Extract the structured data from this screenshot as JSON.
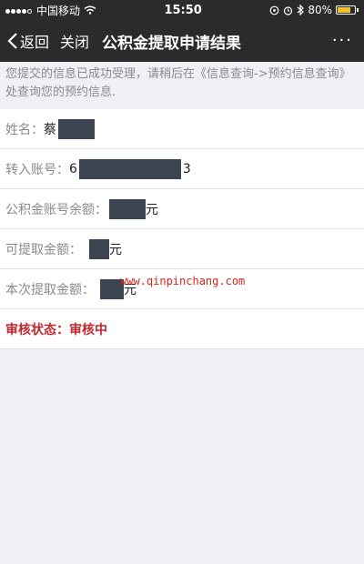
{
  "status_bar": {
    "carrier": "中国移动",
    "time": "15:50",
    "battery": "80%",
    "battery_level": 0.8,
    "wifi_icon": "wifi-icon",
    "alarm_icon": "alarm-icon",
    "bluetooth_icon": "bluetooth-icon"
  },
  "nav": {
    "back_label": "返回",
    "close_label": "关闭",
    "title": "公积金提取申请结果",
    "more_label": "···"
  },
  "notice": "您提交的信息已成功受理，请稍后在《信息查询->预约信息查询》处查询您的预约信息.",
  "rows": [
    {
      "label": "姓名：",
      "value_prefix": "蔡",
      "value_suffix": ""
    },
    {
      "label": "转入账号：",
      "value_prefix": "6",
      "value_suffix": "3"
    },
    {
      "label": "公积金账号余额：",
      "value_prefix": "",
      "value_suffix": "元"
    },
    {
      "label": "可提取金额：",
      "value_prefix": "",
      "value_suffix": "元"
    },
    {
      "label": "本次提取金额：",
      "value_prefix": "",
      "value_suffix": "元"
    }
  ],
  "status": {
    "label": "审核状态：",
    "value": "审核中"
  },
  "watermark": "www.qinpinchang.com",
  "colors": {
    "nav_bg": "#2b2b2b",
    "status_red": "#c1272d",
    "mask": "#3c4452"
  }
}
